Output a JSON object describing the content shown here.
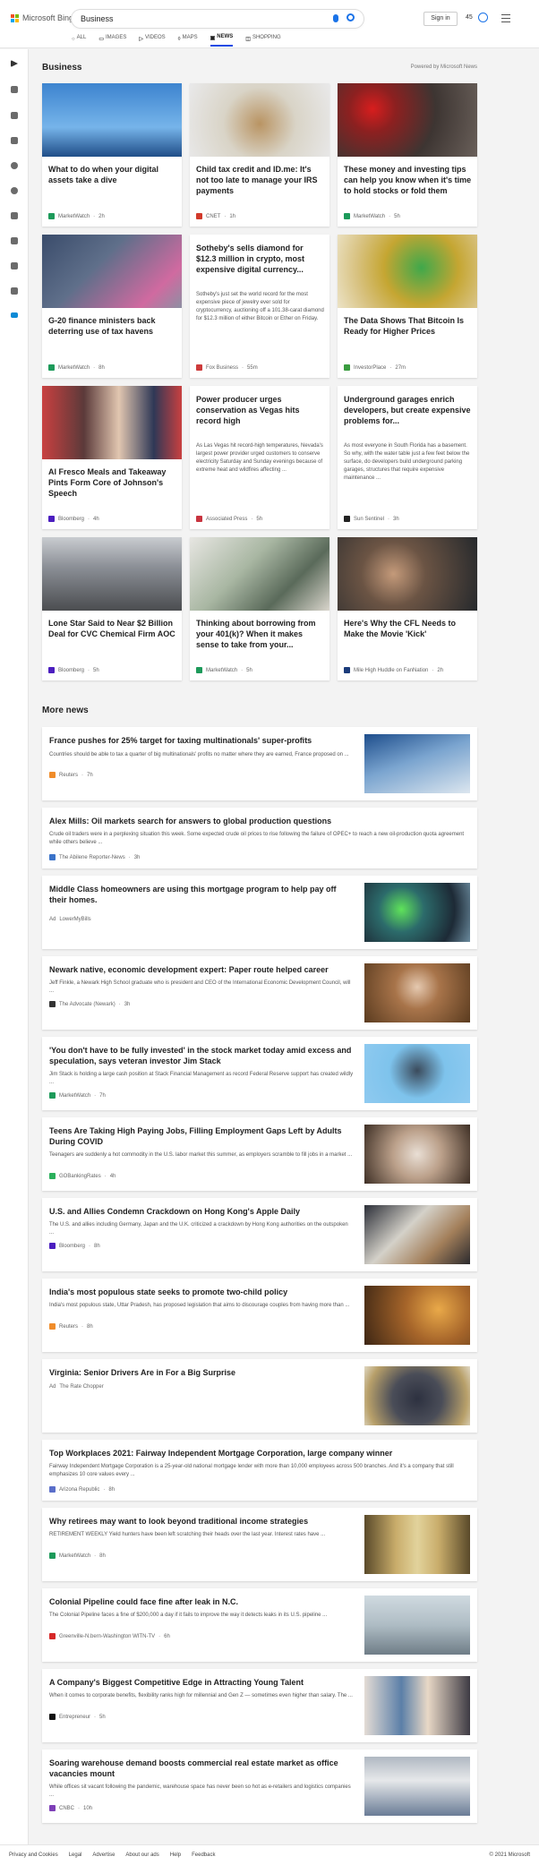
{
  "header": {
    "logo_text": "Microsoft Bing",
    "search_value": "Business",
    "signin_label": "Sign in",
    "rewards_count": "45",
    "tabs": [
      {
        "label": "ALL",
        "icon": "search-icon"
      },
      {
        "label": "IMAGES",
        "icon": "image-icon"
      },
      {
        "label": "VIDEOS",
        "icon": "video-icon"
      },
      {
        "label": "MAPS",
        "icon": "map-pin-icon"
      },
      {
        "label": "NEWS",
        "icon": "news-icon"
      },
      {
        "label": "SHOPPING",
        "icon": "shopping-icon"
      }
    ],
    "active_tab": "NEWS",
    "accent_color": "#174ae4"
  },
  "sidebar": {
    "icons": [
      "expand-icon",
      "home-icon",
      "shuffle-icon",
      "flag-icon",
      "location-icon",
      "globe-icon",
      "science-icon",
      "rocket-icon",
      "film-icon",
      "building-icon",
      "card-icon"
    ]
  },
  "section": {
    "title": "Business",
    "powered_by": "Powered by Microsoft News"
  },
  "top_cards": [
    {
      "title": "What to do when your digital assets take a dive",
      "source": "MarketWatch",
      "time": "2h"
    },
    {
      "title": "Child tax credit and ID.me: It's not too late to manage your IRS payments",
      "source": "CNET",
      "time": "1h"
    },
    {
      "title": "These money and investing tips can help you know when it's time to hold stocks or fold them",
      "source": "MarketWatch",
      "time": "5h"
    },
    {
      "title": "G-20 finance ministers back deterring use of tax havens",
      "source": "MarketWatch",
      "time": "8h"
    },
    {
      "title": "Sotheby's sells diamond for $12.3 million in crypto, most expensive digital currency...",
      "snippet": "Sotheby's just set the world record for the most expensive piece of jewelry ever sold for cryptocurrency, auctioning off a 101.38-carat diamond for $12.3 million of either Bitcoin or Ether on Friday.",
      "source": "Fox Business",
      "time": "55m"
    },
    {
      "title": "The Data Shows That Bitcoin Is Ready for Higher Prices",
      "source": "InvestorPlace",
      "time": "27m"
    },
    {
      "title": "Al Fresco Meals and Takeaway Pints Form Core of Johnson's Speech",
      "source": "Bloomberg",
      "time": "4h"
    },
    {
      "title": "Power producer urges conservation as Vegas hits record high",
      "snippet": "As Las Vegas hit record-high temperatures, Nevada's largest power provider urged customers to conserve electricity Saturday and Sunday evenings because of extreme heat and wildfires affecting ...",
      "source": "Associated Press",
      "time": "5h"
    },
    {
      "title": "Underground garages enrich developers, but create expensive problems for...",
      "snippet": "As most everyone in South Florida has a basement. So why, with the water table just a few feet below the surface, do developers build underground parking garages, structures that require expensive maintenance ...",
      "source": "Sun Sentinel",
      "time": "3h"
    },
    {
      "title": "Lone Star Said to Near $2 Billion Deal for CVC Chemical Firm AOC",
      "source": "Bloomberg",
      "time": "5h"
    },
    {
      "title": "Thinking about borrowing from your 401(k)? When it makes sense to take from your...",
      "source": "MarketWatch",
      "time": "5h"
    },
    {
      "title": "Here's Why the CFL Needs to Make the Movie 'Kick'",
      "source": "Mile High Huddle on FanNation",
      "time": "2h"
    }
  ],
  "more_news_title": "More news",
  "more_news": [
    {
      "title": "France pushes for 25% target for taxing multinationals' super-profits",
      "snippet": "Countries should be able to tax a quarter of big multinationals' profits no matter where they are earned, France proposed on ...",
      "source": "Reuters",
      "time": "7h"
    },
    {
      "title": "Alex Mills: Oil markets search for answers to global production questions",
      "snippet": "Crude oil traders were in a perplexing situation this week. Some expected crude oil prices to rise following the failure of OPEC+ to reach a new oil-production quota agreement while others believe ...",
      "source": "The Abilene Reporter-News",
      "time": "3h"
    },
    {
      "title": "Middle Class homeowners are using this mortgage program to help pay off their homes.",
      "ad": "Ad",
      "source": "LowerMyBills",
      "time": ""
    },
    {
      "title": "Newark native, economic development expert: Paper route helped career",
      "snippet": "Jeff Finkle, a Newark High School graduate who is president and CEO of the International Economic Development Council, will ...",
      "source": "The Advocate (Newark)",
      "time": "3h"
    },
    {
      "title": "'You don't have to be fully invested' in the stock market today amid excess and speculation, says veteran investor Jim Stack",
      "snippet": "Jim Stack is holding a large cash position at Stack Financial Management as record Federal Reserve support has created wildly ...",
      "source": "MarketWatch",
      "time": "7h"
    },
    {
      "title": "Teens Are Taking High Paying Jobs, Filling Employment Gaps Left by Adults During COVID",
      "snippet": "Teenagers are suddenly a hot commodity in the U.S. labor market this summer, as employers scramble to fill jobs in a market ...",
      "source": "GOBankingRates",
      "time": "4h"
    },
    {
      "title": "U.S. and Allies Condemn Crackdown on Hong Kong's Apple Daily",
      "snippet": "The U.S. and allies including Germany, Japan and the U.K. criticized a crackdown by Hong Kong authorities on the outspoken ...",
      "source": "Bloomberg",
      "time": "8h"
    },
    {
      "title": "India's most populous state seeks to promote two-child policy",
      "snippet": "India's most populous state, Uttar Pradesh, has proposed legislation that aims to discourage couples from having more than ...",
      "source": "Reuters",
      "time": "8h"
    },
    {
      "title": "Virginia: Senior Drivers Are in For a Big Surprise",
      "ad": "Ad",
      "source": "The Rate Chopper",
      "time": ""
    },
    {
      "title": "Top Workplaces 2021: Fairway Independent Mortgage Corporation, large company winner",
      "snippet": "Fairway Independent Mortgage Corporation is a 25-year-old national mortgage lender with more than 10,000 employees across 500 branches. And it's a company that still emphasizes 10 core values every ...",
      "source": "Arizona Republic",
      "time": "8h"
    },
    {
      "title": "Why retirees may want to look beyond traditional income strategies",
      "snippet": "RETIREMENT WEEKLY Yield hunters have been left scratching their heads over the last year. Interest rates have ...",
      "source": "MarketWatch",
      "time": "8h"
    },
    {
      "title": "Colonial Pipeline could face fine after leak in N.C.",
      "snippet": "The Colonial Pipeline faces a fine of $200,000 a day if it fails to improve the way it detects leaks in its U.S. pipeline ...",
      "source": "Greenville-N.bern-Washington WITN-TV",
      "time": "6h"
    },
    {
      "title": "A Company's Biggest Competitive Edge in Attracting Young Talent",
      "snippet": "When it comes to corporate benefits, flexibility ranks high for millennial and Gen Z — sometimes even higher than salary. The ...",
      "source": "Entrepreneur",
      "time": "5h"
    },
    {
      "title": "Soaring warehouse demand boosts commercial real estate market as office vacancies mount",
      "snippet": "While offices sit vacant following the pandemic, warehouse space has never been so hot as e-retailers and logistics companies ...",
      "source": "CNBC",
      "time": "10h"
    }
  ],
  "footer": {
    "links": [
      "Privacy and Cookies",
      "Legal",
      "Advertise",
      "About our ads",
      "Help",
      "Feedback"
    ],
    "copyright": "© 2021 Microsoft"
  }
}
